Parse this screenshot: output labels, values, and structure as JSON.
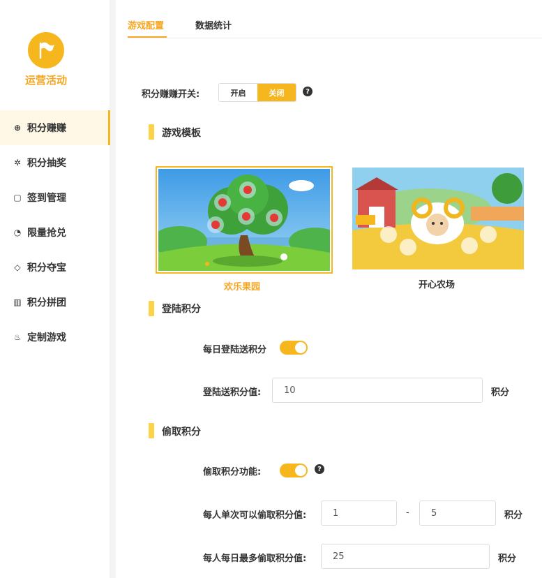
{
  "sidebar": {
    "logo_text": "运营活动",
    "items": [
      {
        "label": "积分赚赚",
        "icon": "basketball-icon",
        "glyph": "⊕"
      },
      {
        "label": "积分抽奖",
        "icon": "wheel-icon",
        "glyph": "✲"
      },
      {
        "label": "签到管理",
        "icon": "calendar-icon",
        "glyph": "▢"
      },
      {
        "label": "限量抢兑",
        "icon": "timer-icon",
        "glyph": "◔"
      },
      {
        "label": "积分夺宝",
        "icon": "diamond-icon",
        "glyph": "◇"
      },
      {
        "label": "积分拼团",
        "icon": "building-icon",
        "glyph": "▥"
      },
      {
        "label": "定制游戏",
        "icon": "flame-icon",
        "glyph": "♨"
      }
    ]
  },
  "tabs": [
    {
      "label": "游戏配置"
    },
    {
      "label": "数据统计"
    }
  ],
  "switch_row": {
    "label": "积分赚赚开关:",
    "on_label": "开启",
    "off_label": "关闭",
    "selected": "关闭"
  },
  "game_template": {
    "title": "游戏模板",
    "cards": [
      {
        "caption": "欢乐果园",
        "selected": true
      },
      {
        "caption": "开心农场",
        "selected": false
      }
    ]
  },
  "login_points": {
    "title": "登陆积分",
    "daily_label": "每日登陆送积分",
    "daily_enabled": true,
    "value_label": "登陆送积分值:",
    "value": "10",
    "unit": "积分"
  },
  "steal_points": {
    "title": "偷取积分",
    "feature_label": "偷取积分功能:",
    "feature_enabled": true,
    "per_steal_label": "每人单次可以偷取积分值:",
    "per_steal_min": "1",
    "range_sep": "-",
    "per_steal_max": "5",
    "unit": "积分",
    "daily_max_label": "每人每日最多偷取积分值:",
    "daily_max": "25"
  },
  "colors": {
    "accent": "#f6b61d",
    "accent_text": "#f6a623",
    "section_bar": "#fbd24a"
  }
}
